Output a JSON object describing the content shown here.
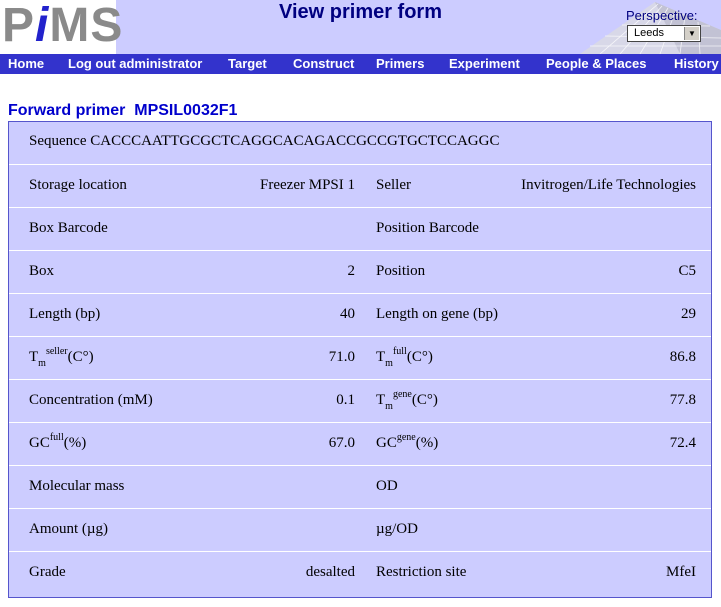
{
  "logo": {
    "p": "P",
    "i": "i",
    "ms": "MS"
  },
  "header": {
    "title": "View primer form"
  },
  "perspective": {
    "label": "Perspective:",
    "value": "Leeds"
  },
  "nav": [
    "Home",
    "Log out administrator",
    "Target",
    "Construct",
    "Primers",
    "Experiment",
    "People & Places",
    "History"
  ],
  "primer": {
    "heading": "Forward primer  MPSIL0032F1",
    "sequence_label": "Sequence",
    "sequence": "CACCCAATTGCGCTCAGGCACAGACCGCCGTGCTCCAGGC"
  },
  "fields": {
    "storage_location": {
      "label": "Storage location",
      "value": "Freezer MPSI 1"
    },
    "seller": {
      "label": "Seller",
      "value": "Invitrogen/Life Technologies"
    },
    "box_barcode": {
      "label": "Box Barcode",
      "value": ""
    },
    "position_barcode": {
      "label": "Position Barcode",
      "value": ""
    },
    "box": {
      "label": "Box",
      "value": "2"
    },
    "position": {
      "label": "Position",
      "value": "C5"
    },
    "length": {
      "label": "Length (bp)",
      "value": "40"
    },
    "length_on_gene": {
      "label": "Length on gene (bp)",
      "value": "29"
    },
    "tm_seller": {
      "pre": "T",
      "sub": "m",
      "sup": "seller",
      "unit": "(C°)",
      "value": "71.0"
    },
    "tm_full": {
      "pre": "T",
      "sub": "m",
      "sup": "full",
      "unit": "(C°)",
      "value": "86.8"
    },
    "concentration": {
      "label": "Concentration (mM)",
      "value": "0.1"
    },
    "tm_gene": {
      "pre": "T",
      "sub": "m",
      "sup": "gene",
      "unit": "(C°)",
      "value": "77.8"
    },
    "gc_full": {
      "pre": "GC",
      "sup": "full",
      "unit": "(%)",
      "value": "67.0"
    },
    "gc_gene": {
      "pre": "GC",
      "sup": "gene",
      "unit": "(%)",
      "value": "72.4"
    },
    "molecular_mass": {
      "label": "Molecular mass",
      "value": ""
    },
    "od": {
      "label": "OD",
      "value": ""
    },
    "amount": {
      "label": "Amount (µg)",
      "value": ""
    },
    "ug_od": {
      "label": "µg/OD",
      "value": ""
    },
    "grade": {
      "label": "Grade",
      "value": "desalted"
    },
    "restriction_site": {
      "label": "Restriction site",
      "value": "MfeI"
    }
  }
}
